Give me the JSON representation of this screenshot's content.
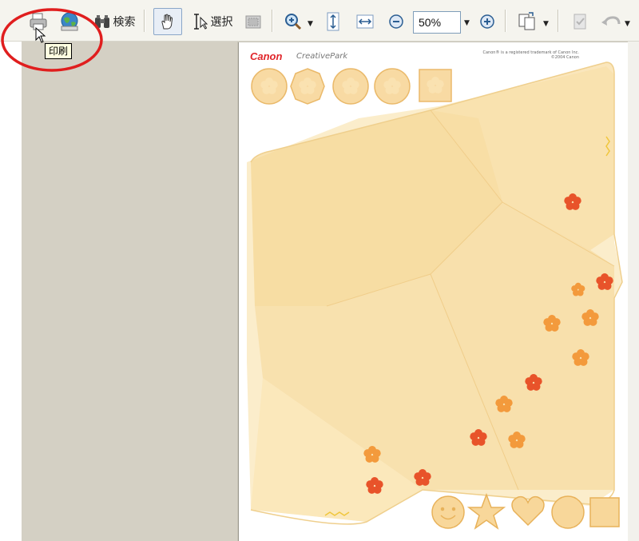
{
  "toolbar": {
    "search_label": "検索",
    "select_label": "選択",
    "zoom_value": "50%",
    "icons": [
      "print-icon",
      "web-icon",
      "binoculars-icon",
      "hand-icon",
      "select-text-icon",
      "snapshot-icon",
      "zoom-in-icon",
      "fit-height-icon",
      "fit-width-icon",
      "zoom-out-icon",
      "zoom-plus-icon",
      "pages-icon",
      "stamp-icon",
      "undo-icon"
    ]
  },
  "tooltip": {
    "text": "印刷"
  },
  "page": {
    "brand": "Canon",
    "product": "CreativePark",
    "note": "Canon® is a registered trademark of Canon Inc. ©2004 Canon",
    "colors": {
      "paper": "#f8dfa0",
      "flower": "#e8532a",
      "flower_light": "#f39a3c",
      "badge": "#f6c971"
    }
  },
  "annotation": {
    "color": "#e01e1e"
  }
}
